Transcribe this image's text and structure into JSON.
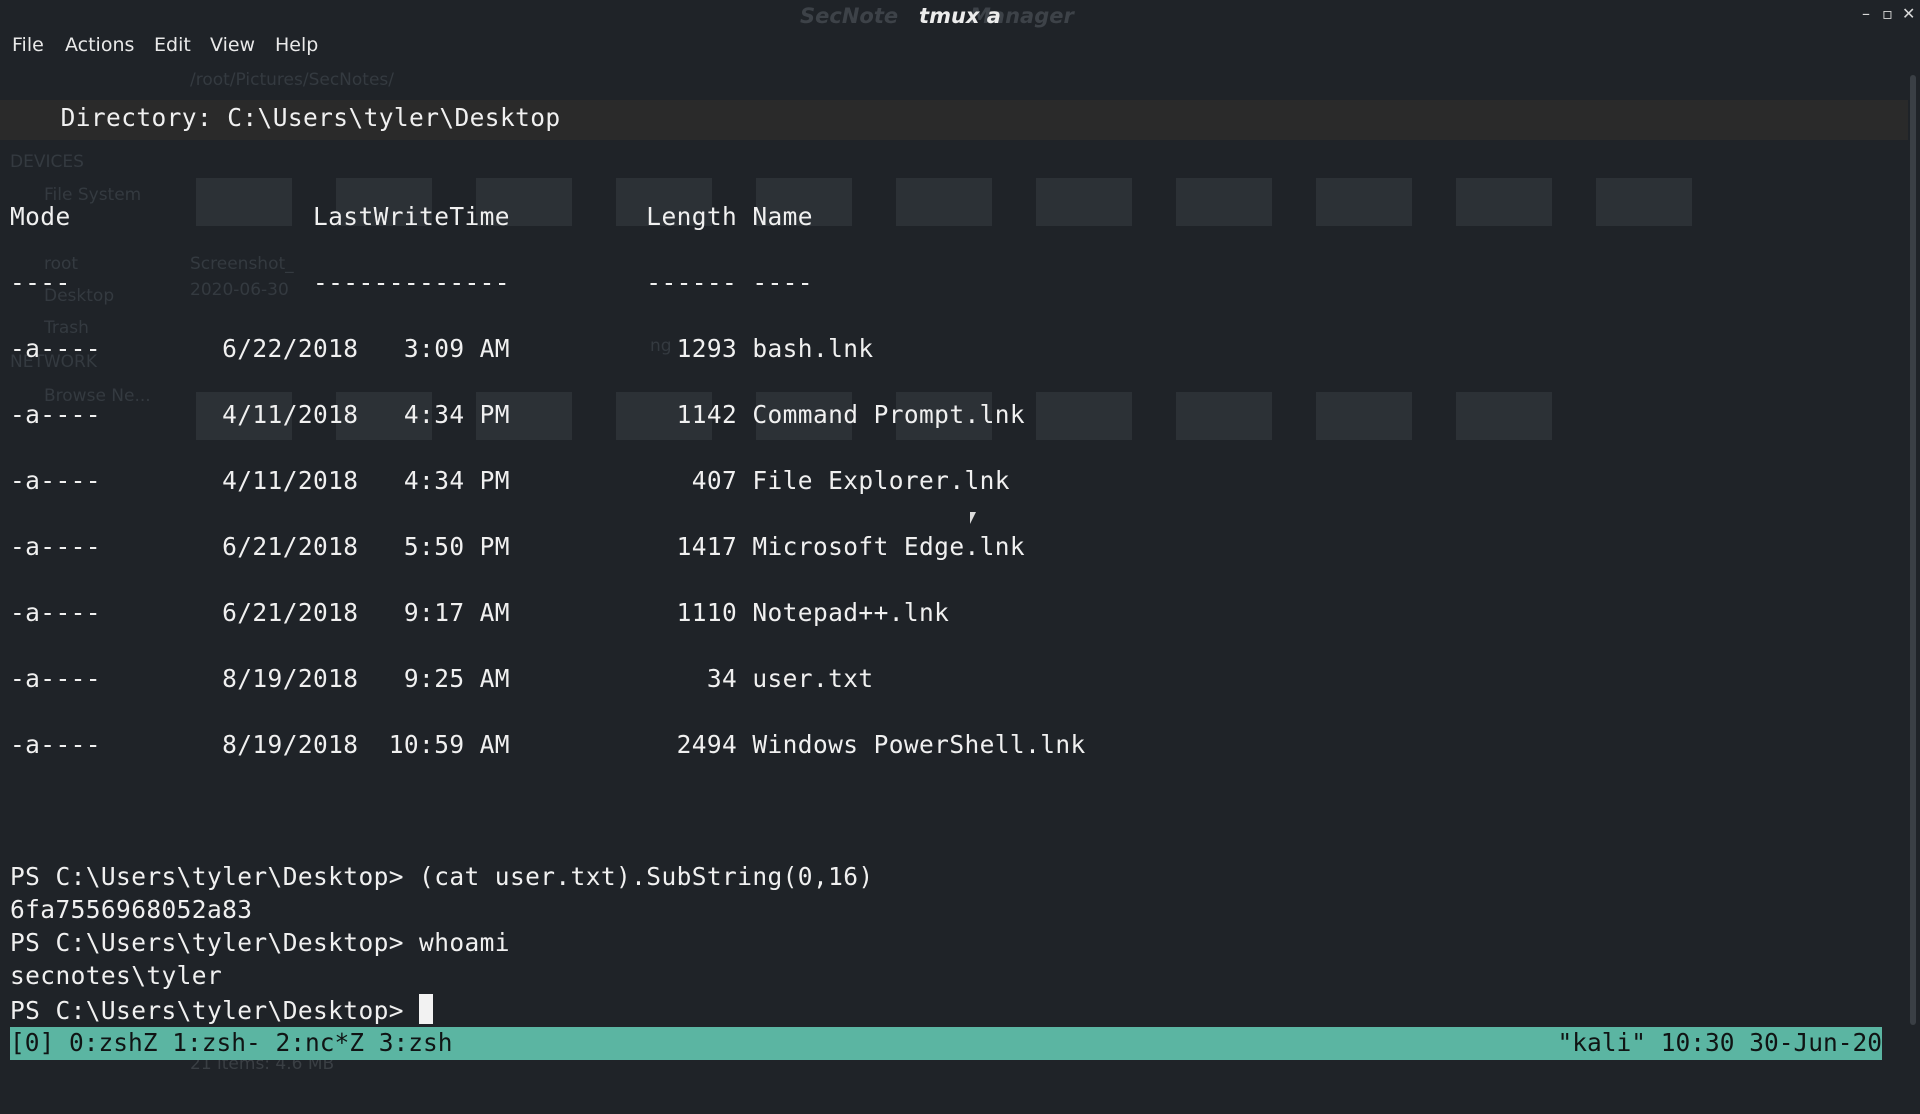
{
  "window": {
    "title": "tmux a",
    "ghost_title_left": "SecNote",
    "ghost_title_right": "Manager",
    "controls": [
      "–",
      "▫",
      "✕"
    ]
  },
  "menu": [
    "File",
    "Actions",
    "Edit",
    "View",
    "Help"
  ],
  "background_filemanager": {
    "path": "/root/Pictures/SecNotes/",
    "sidebar": [
      "DEVICES",
      "File System",
      "root",
      "Desktop",
      "Trash",
      "NETWORK",
      "Browse Ne..."
    ],
    "thumb_labels": [
      "Screenshot_",
      "2020-06-30",
      "ng"
    ],
    "status": "21 items: 4.6 MB"
  },
  "terminal": {
    "directory_line": "    Directory: C:\\Users\\tyler\\Desktop",
    "header": "Mode                LastWriteTime         Length Name",
    "header_rule": "----                -------------         ------ ----",
    "rows": [
      "-a----        6/22/2018   3:09 AM           1293 bash.lnk",
      "-a----        4/11/2018   4:34 PM           1142 Command Prompt.lnk",
      "-a----        4/11/2018   4:34 PM            407 File Explorer.lnk",
      "-a----        6/21/2018   5:50 PM           1417 Microsoft Edge.lnk",
      "-a----        6/21/2018   9:17 AM           1110 Notepad++.lnk",
      "-a----        8/19/2018   9:25 AM             34 user.txt",
      "-a----        8/19/2018  10:59 AM           2494 Windows PowerShell.lnk"
    ],
    "history": [
      "PS C:\\Users\\tyler\\Desktop> (cat user.txt).SubString(0,16)",
      "6fa7556968052a83",
      "PS C:\\Users\\tyler\\Desktop> whoami",
      "secnotes\\tyler"
    ],
    "prompt": "PS C:\\Users\\tyler\\Desktop> "
  },
  "tmux_status": {
    "left": "[0] 0:zshZ 1:zsh- 2:nc*Z 3:zsh",
    "right": "\"kali\" 10:30 30-Jun-20",
    "color": "#5bb5a2"
  }
}
